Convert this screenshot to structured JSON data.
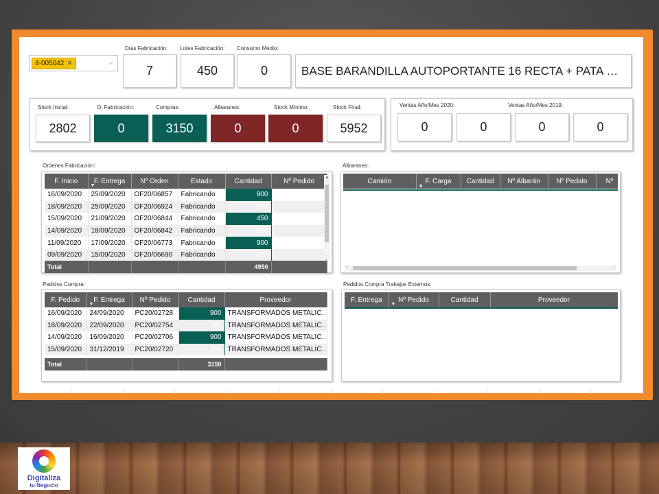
{
  "slicer": {
    "value": "4-005042",
    "clear_icon": "close-icon",
    "dropdown_icon": "chevron-down-icon"
  },
  "top_kpis": [
    {
      "label": "Días Fabricación:",
      "value": "7"
    },
    {
      "label": "Lotes Fabricación:",
      "value": "450"
    },
    {
      "label": "Consumo Medio:",
      "value": "0"
    }
  ],
  "product_title": "BASE BARANDILLA AUTOPORTANTE 16 RECTA + PATA …",
  "stock_kpis": [
    {
      "label": "Stock Inicial:",
      "value": "2802",
      "style": "plain"
    },
    {
      "label": "O. Fabricación:",
      "value": "0",
      "style": "teal"
    },
    {
      "label": "Compras:",
      "value": "3150",
      "style": "teal"
    },
    {
      "label": "Albaranes:",
      "value": "0",
      "style": "red"
    },
    {
      "label": "Stock Mínimo:",
      "value": "0",
      "style": "red"
    },
    {
      "label": "Stock Final:",
      "value": "5952",
      "style": "plain"
    }
  ],
  "sales": {
    "label_2020": "Ventas Año/Mes 2020:",
    "label_2019": "Ventas Año/Mes 2019:",
    "values": [
      "0",
      "0",
      "0",
      "0"
    ]
  },
  "ordenes": {
    "title": "Ordenes Fabricación:",
    "columns": [
      "F. Inicio",
      "F. Entrega",
      "Nº Orden",
      "Estado",
      "Cantidad",
      "Nº Pedido"
    ],
    "rows": [
      [
        "16/09/2020",
        "25/09/2020",
        "OF20/06857",
        "Fabricando",
        "900",
        ""
      ],
      [
        "18/09/2020",
        "25/09/2020",
        "OF20/06924",
        "Fabricando",
        "900",
        ""
      ],
      [
        "15/09/2020",
        "21/09/2020",
        "OF20/06844",
        "Fabricando",
        "450",
        ""
      ],
      [
        "14/09/2020",
        "18/09/2020",
        "OF20/06842",
        "Fabricando",
        "900",
        ""
      ],
      [
        "11/09/2020",
        "17/09/2020",
        "OF20/06773",
        "Fabricando",
        "900",
        ""
      ],
      [
        "09/09/2020",
        "15/09/2020",
        "OF20/06690",
        "Fabricando",
        "450",
        ""
      ]
    ],
    "total_label": "Total",
    "total_value": "4950"
  },
  "albaranes": {
    "title": "Albaranes:",
    "columns": [
      "Camión",
      "F. Carga",
      "Cantidad",
      "Nº Albarán",
      "Nº Pedido",
      "Nº"
    ]
  },
  "pedidos": {
    "title": "Pedidos Compra:",
    "columns": [
      "F. Pedido",
      "F. Entrega",
      "Nº Pedido",
      "Cantidad",
      "Proveedor"
    ],
    "rows": [
      [
        "16/09/2020",
        "24/09/2020",
        "PC20/02728",
        "900",
        "TRANSFORMADOS METALIC…"
      ],
      [
        "18/09/2020",
        "22/09/2020",
        "PC20/02754",
        "900",
        "TRANSFORMADOS METALIC…"
      ],
      [
        "14/09/2020",
        "16/09/2020",
        "PC20/02706",
        "900",
        "TRANSFORMADOS METALIC…"
      ],
      [
        "15/09/2020",
        "31/12/2019",
        "PC20/02720",
        "450",
        "TRANSFORMADOS METALIC…"
      ]
    ],
    "total_label": "Total",
    "total_value": "3150"
  },
  "externos": {
    "title": "Pedidos Compra Trabajos Externos:",
    "columns": [
      "F. Entrega",
      "Nº Pedido",
      "Cantidad",
      "Proveedor"
    ]
  },
  "logo": {
    "line1": "Digitaliza",
    "line2": "tu Negocio"
  },
  "colors": {
    "frame": "#f28a2e",
    "teal": "#0a5f55",
    "red": "#7f2626",
    "header": "#5f5f5f"
  }
}
